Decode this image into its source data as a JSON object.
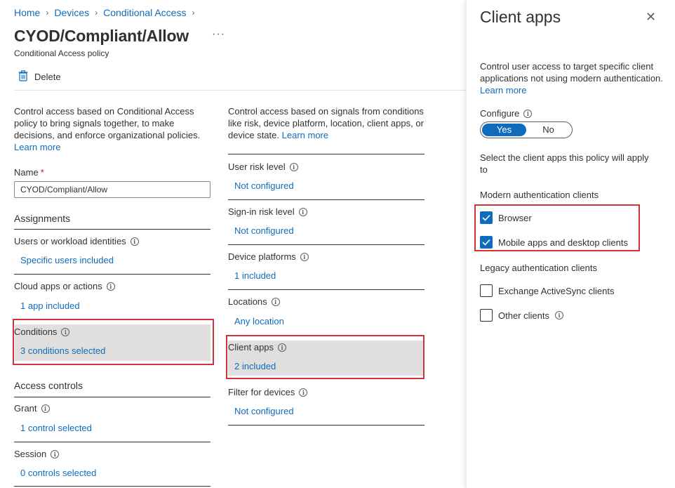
{
  "breadcrumb": [
    "Home",
    "Devices",
    "Conditional Access"
  ],
  "page": {
    "title": "CYOD/Compliant/Allow",
    "subtitle": "Conditional Access policy",
    "more": "···",
    "delete_label": "Delete"
  },
  "left": {
    "description": "Control access based on Conditional Access policy to bring signals together, to make decisions, and enforce organizational policies.",
    "learn_more": "Learn more",
    "name_label": "Name",
    "required_mark": "*",
    "name_value": "CYOD/Compliant/Allow",
    "assignments_title": "Assignments",
    "users_label": "Users or workload identities",
    "users_value": "Specific users included",
    "cloud_label": "Cloud apps or actions",
    "cloud_value": "1 app included",
    "conditions_label": "Conditions",
    "conditions_value": "3 conditions selected",
    "access_title": "Access controls",
    "grant_label": "Grant",
    "grant_value": "1 control selected",
    "session_label": "Session",
    "session_value": "0 controls selected"
  },
  "middle": {
    "description": "Control access based on signals from conditions like risk, device platform, location, client apps, or device state.",
    "learn_more": "Learn more",
    "user_risk_label": "User risk level",
    "user_risk_value": "Not configured",
    "signin_risk_label": "Sign-in risk level",
    "signin_risk_value": "Not configured",
    "device_platforms_label": "Device platforms",
    "device_platforms_value": "1 included",
    "locations_label": "Locations",
    "locations_value": "Any location",
    "client_apps_label": "Client apps",
    "client_apps_value": "2 included",
    "filter_label": "Filter for devices",
    "filter_value": "Not configured"
  },
  "panel": {
    "title": "Client apps",
    "description": "Control user access to target specific client applications not using modern authentication.",
    "learn_more": "Learn more",
    "configure_label": "Configure",
    "toggle_yes": "Yes",
    "toggle_no": "No",
    "toggle_selected": "Yes",
    "select_text": "Select the client apps this policy will apply to",
    "modern_title": "Modern authentication clients",
    "browser_label": "Browser",
    "browser_checked": true,
    "mobile_label": "Mobile apps and desktop clients",
    "mobile_checked": true,
    "legacy_title": "Legacy authentication clients",
    "eas_label": "Exchange ActiveSync clients",
    "eas_checked": false,
    "other_label": "Other clients",
    "other_checked": false
  },
  "colors": {
    "accent": "#0f6cbd",
    "highlight_red": "#d13438",
    "selected_row_bg": "#e1dfdd"
  },
  "icons": {
    "delete": "trash-icon",
    "info": "info-icon",
    "close": "close-icon",
    "check": "checkmark-icon"
  }
}
